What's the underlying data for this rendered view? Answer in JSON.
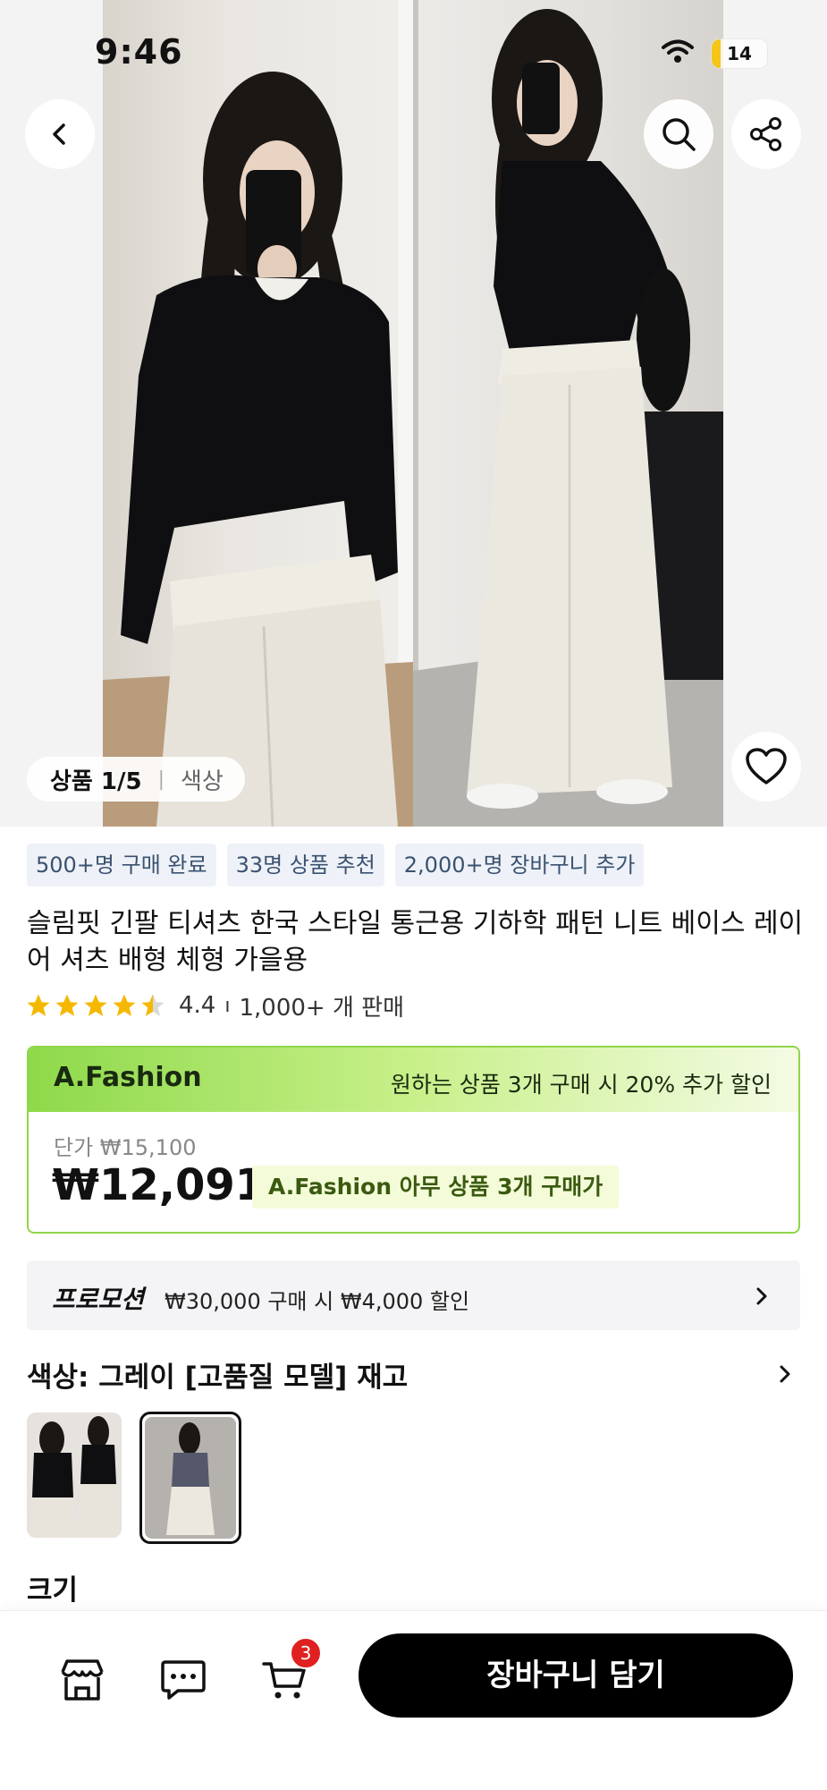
{
  "status_bar": {
    "time": "9:46",
    "battery": "14"
  },
  "gallery": {
    "counter": "상품 1/5",
    "counter_tab": "색상"
  },
  "tags": [
    "500+명 구매 완료",
    "33명 상품 추천",
    "2,000+명 장바구니 추가"
  ],
  "product": {
    "title": "슬림핏 긴팔 티셔츠 한국 스타일 통근용 기하학 패턴 니트 베이스 레이어 셔츠 배형 체형 가을용",
    "rating": "4.4",
    "rating_value": 4.4,
    "sold": "1,000+ 개 판매"
  },
  "price_box": {
    "store": "A.Fashion",
    "store_promo": "원하는 상품 3개 구매 시 20% 추가 할인",
    "unit_price": "단가 ₩15,100",
    "price": "₩12,091",
    "deal": "A.Fashion 아무 상품 3개 구매가"
  },
  "promotion": {
    "label": "프로모션",
    "text": "₩30,000 구매 시 ₩4,000 할인"
  },
  "color": {
    "label": "색상: 그레이 [고품질 모델] 재고"
  },
  "size": {
    "label": "크기"
  },
  "bottom_bar": {
    "cart_count": "3",
    "add_to_cart": "장바구니 담기"
  },
  "icons": [
    "back-icon",
    "search-icon",
    "share-icon",
    "heart-icon",
    "store-icon",
    "chat-icon",
    "cart-icon",
    "chevron-right-icon",
    "wifi-icon",
    "battery-icon"
  ],
  "colors": {
    "accent_green": "#8fd64a",
    "star": "#f5b800",
    "cta": "#000000",
    "badge": "#e02020"
  }
}
